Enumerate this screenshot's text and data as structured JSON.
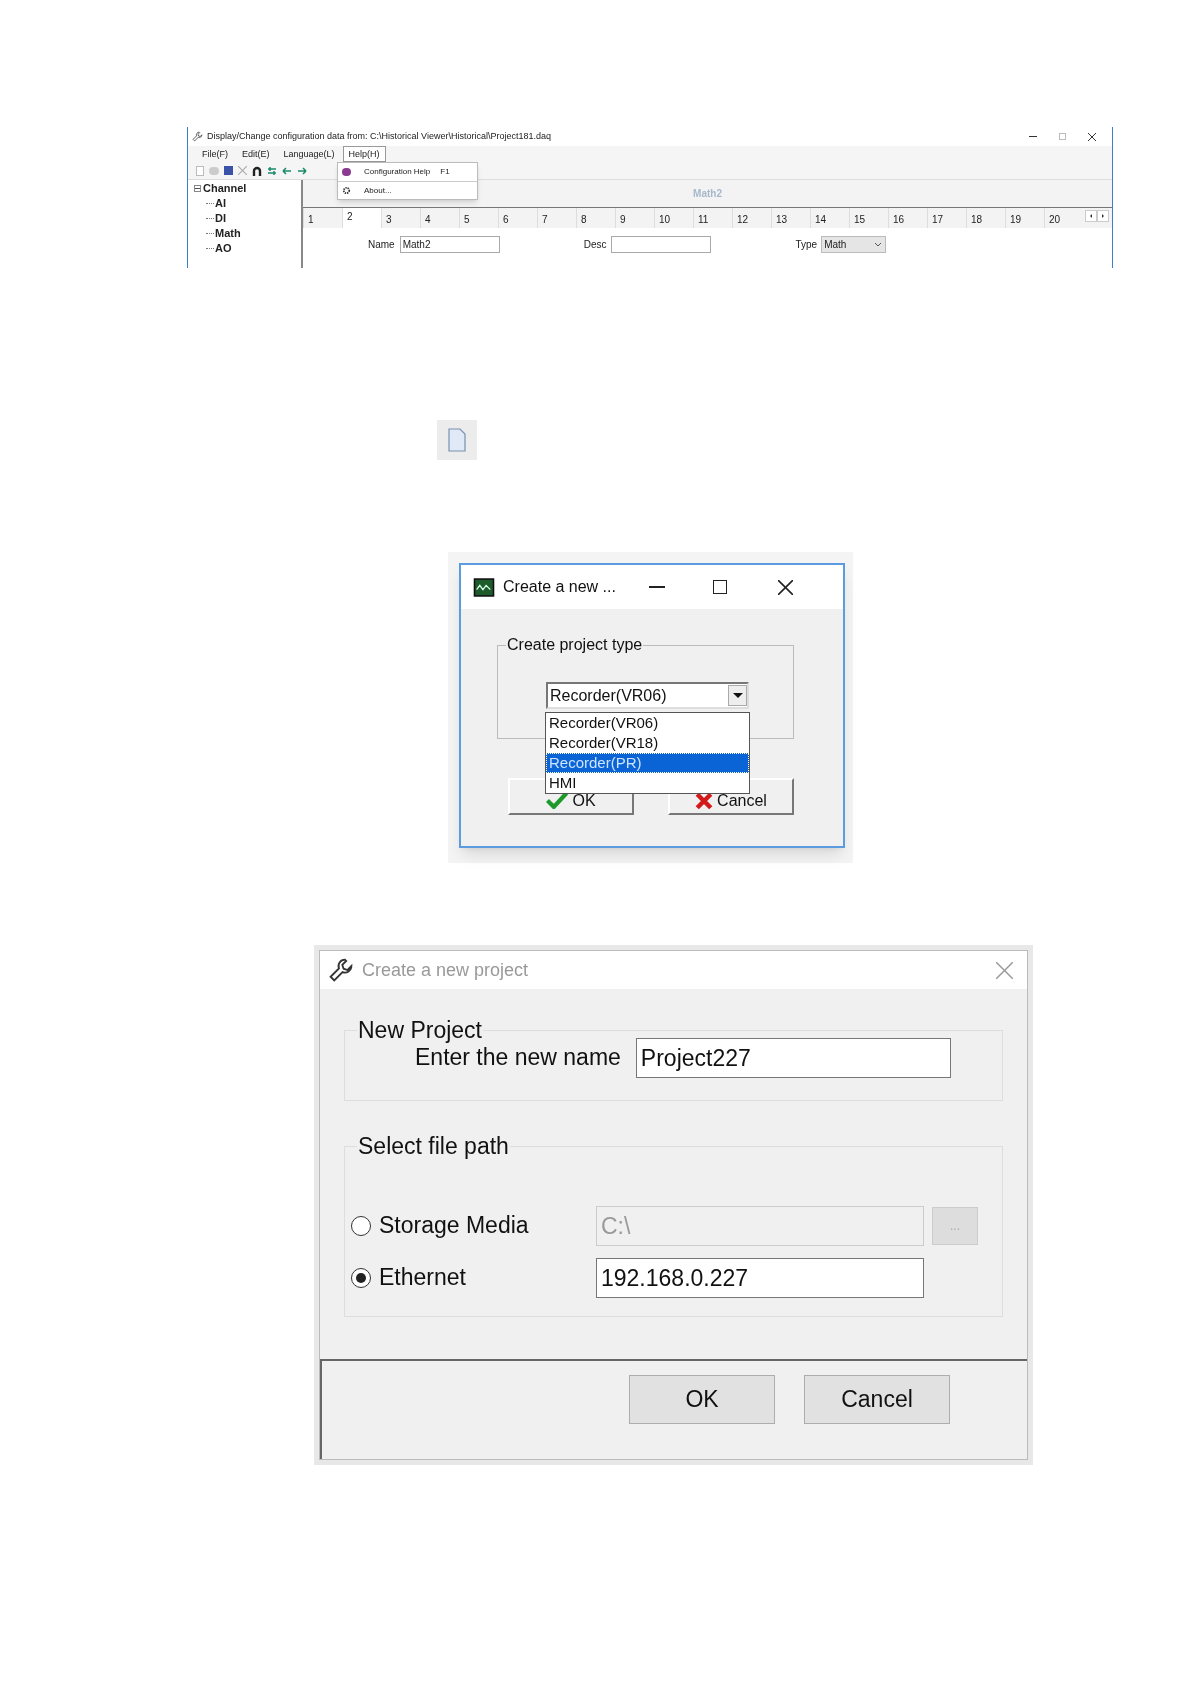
{
  "config_window": {
    "title": "Display/Change configuration data from: C:\\Historical Viewer\\Historical\\Project181.daq",
    "menu": [
      {
        "label": "File(F)",
        "selected": false
      },
      {
        "label": "Edit(E)",
        "selected": false
      },
      {
        "label": "Language(L)",
        "selected": false
      },
      {
        "label": "Help(H)",
        "selected": true
      }
    ],
    "help_menu": [
      {
        "kind": "help",
        "label": "Configuration Help",
        "shortcut": "F1"
      },
      {
        "kind": "about",
        "label": "About..."
      }
    ],
    "tree": {
      "label": "Channel",
      "expanded": true,
      "children": [
        {
          "label": "AI"
        },
        {
          "label": "DI"
        },
        {
          "label": "Math"
        },
        {
          "label": "AO"
        }
      ]
    },
    "panel_title": "Math2",
    "tabs": [
      {
        "label": "1",
        "selected": false
      },
      {
        "label": "2",
        "selected": true
      },
      {
        "label": "3",
        "selected": false
      },
      {
        "label": "4",
        "selected": false
      },
      {
        "label": "5",
        "selected": false
      },
      {
        "label": "6",
        "selected": false
      },
      {
        "label": "7",
        "selected": false
      },
      {
        "label": "8",
        "selected": false
      },
      {
        "label": "9",
        "selected": false
      },
      {
        "label": "10",
        "selected": false
      },
      {
        "label": "11",
        "selected": false
      },
      {
        "label": "12",
        "selected": false
      },
      {
        "label": "13",
        "selected": false
      },
      {
        "label": "14",
        "selected": false
      },
      {
        "label": "15",
        "selected": false
      },
      {
        "label": "16",
        "selected": false
      },
      {
        "label": "17",
        "selected": false
      },
      {
        "label": "18",
        "selected": false
      },
      {
        "label": "19",
        "selected": false
      },
      {
        "label": "20",
        "selected": false
      }
    ],
    "name_label": "Name",
    "name_value": "Math2",
    "desc_label": "Desc",
    "type_label": "Type",
    "type_value": "Math"
  },
  "type_dialog": {
    "title": "Create a new ...",
    "group_label": "Create project type",
    "combo_value": "Recorder(VR06)",
    "options": [
      {
        "label": "Recorder(VR06)",
        "selected": false
      },
      {
        "label": "Recorder(VR18)",
        "selected": false
      },
      {
        "label": "Recorder(PR)",
        "selected": true
      },
      {
        "label": "HMI",
        "selected": false
      }
    ],
    "buttons": [
      {
        "kind": "ok",
        "label": "OK"
      },
      {
        "kind": "cancel",
        "label": "Cancel"
      }
    ]
  },
  "project_dialog": {
    "title": "Create a new project",
    "group1_label": "New Project",
    "name_label": "Enter the new name",
    "name_value": "Project227",
    "group2_label": "Select file path",
    "paths": [
      {
        "label": "Storage Media",
        "selected": false,
        "value": "C:\\",
        "browse": "..."
      },
      {
        "label": "Ethernet",
        "selected": true,
        "value": "192.168.0.227"
      }
    ],
    "buttons": [
      {
        "label": "OK"
      },
      {
        "label": "Cancel"
      }
    ]
  }
}
